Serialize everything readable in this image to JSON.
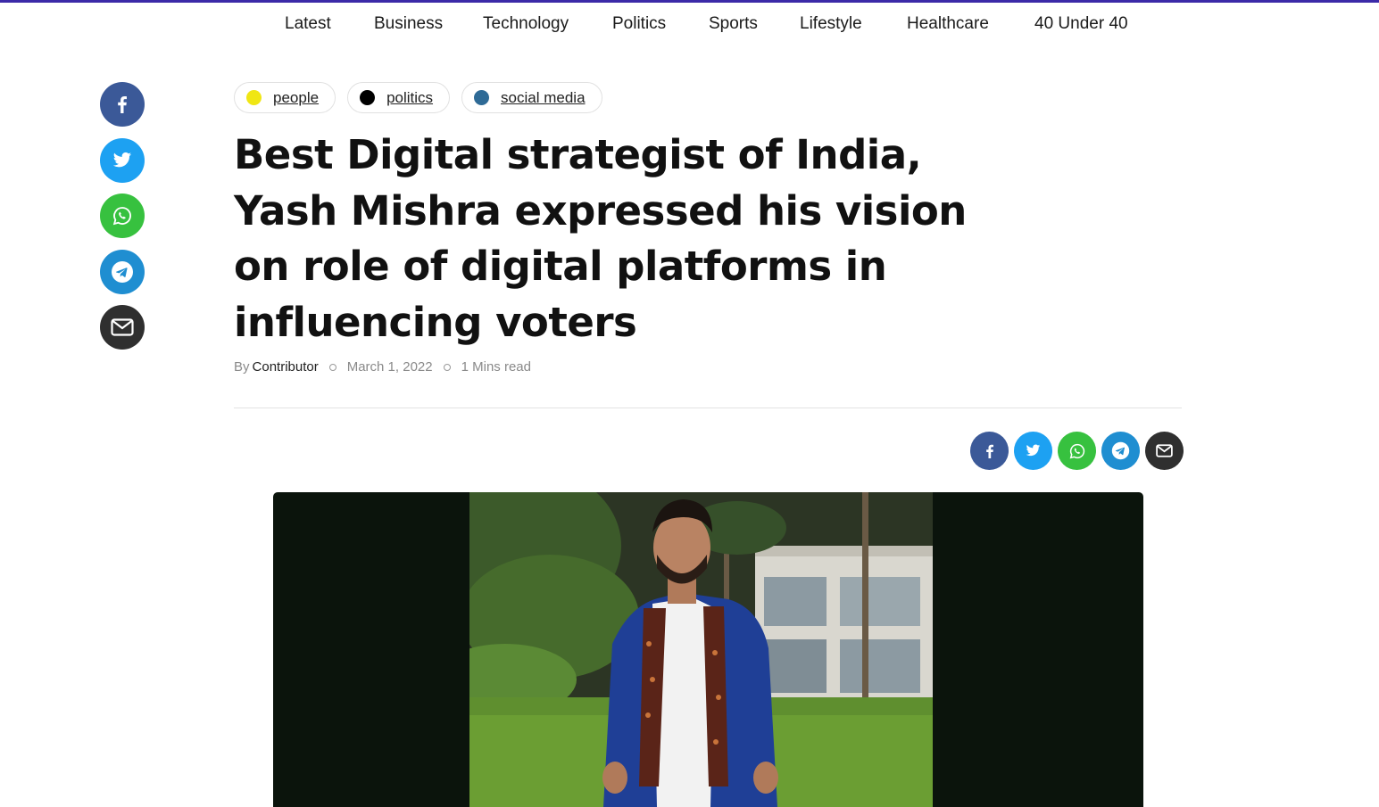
{
  "nav": {
    "items": [
      "Latest",
      "Business",
      "Technology",
      "Politics",
      "Sports",
      "Lifestyle",
      "Healthcare",
      "40 Under 40"
    ]
  },
  "colors": {
    "accent_line": "#3b2aa8",
    "facebook": "#3b5998",
    "twitter": "#1da1f2",
    "whatsapp": "#37c13f",
    "telegram": "#1f8ed1",
    "email": "#2f2f2f"
  },
  "share_icons": [
    "facebook-icon",
    "twitter-icon",
    "whatsapp-icon",
    "telegram-icon",
    "email-icon"
  ],
  "tags": [
    {
      "label": "people",
      "color": "#f0e614"
    },
    {
      "label": "politics",
      "color": "#000000"
    },
    {
      "label": "social media",
      "color": "#2e6a96"
    }
  ],
  "article": {
    "title": "Best Digital strategist of India, Yash Mishra expressed his vision on role of digital platforms in influencing voters",
    "by_label": "By",
    "author": "Contributor",
    "date": "March 1, 2022",
    "read_time": "1 Mins read"
  }
}
